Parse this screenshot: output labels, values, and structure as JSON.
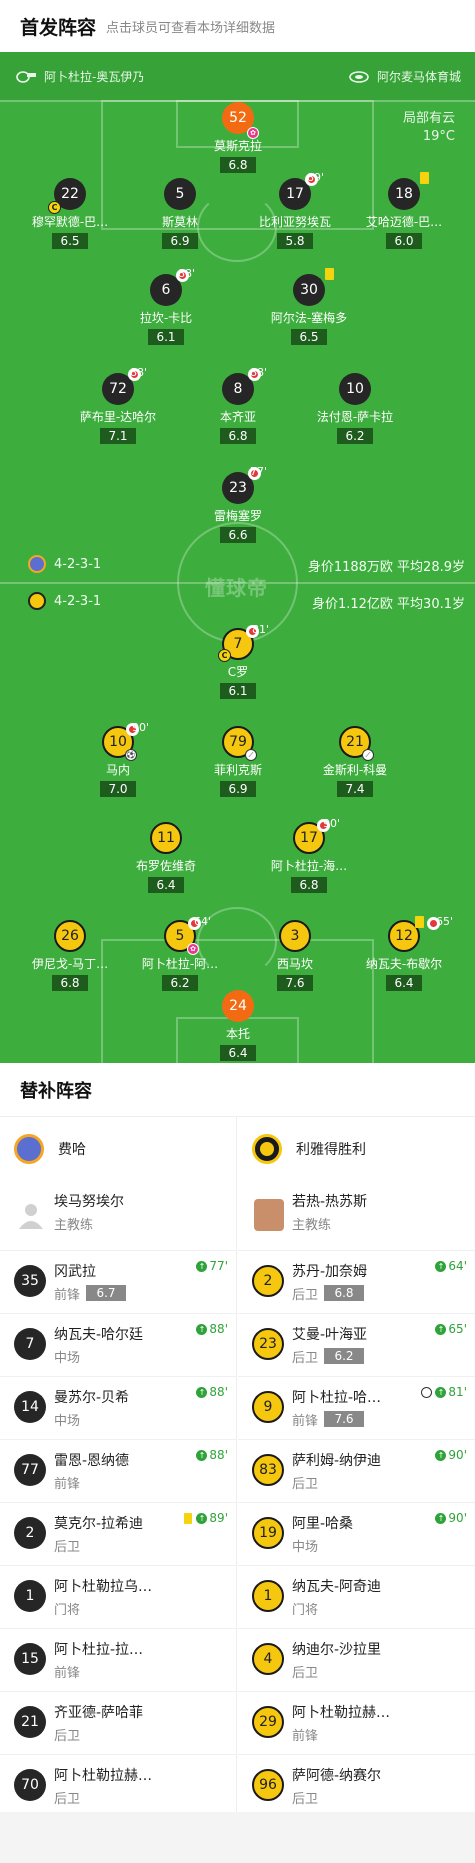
{
  "header": {
    "title": "首发阵容",
    "hint": "点击球员可查看本场详细数据"
  },
  "pitch": {
    "home_team": "阿卜杜拉-奥瓦伊乃",
    "venue": "阿尔麦马体育城",
    "weather": "局部有云",
    "temperature": "19°C",
    "watermark": "懂球帝",
    "home_formation": "4-2-3-1",
    "home_value": "身价1188万欧  平均28.9岁",
    "away_formation": "4-2-3-1",
    "away_value": "身价1.12亿欧  平均30.1岁",
    "colors": {
      "pitch": "#3dae3d",
      "home_circle": "#262626",
      "away_circle": "#f5c70f",
      "gk_circle": "#f26b12"
    }
  },
  "home_players": [
    {
      "num": "52",
      "name": "莫斯克拉",
      "rating": "6.8",
      "style": "orange",
      "icon": "award-icon"
    },
    {
      "num": "22",
      "name": "穆罕默德-巴…",
      "rating": "6.5",
      "style": "dark",
      "captain": true
    },
    {
      "num": "5",
      "name": "斯莫林",
      "rating": "6.9",
      "style": "dark"
    },
    {
      "num": "17",
      "name": "比利亚努埃瓦",
      "rating": "5.8",
      "style": "dark",
      "sub_min": "89'"
    },
    {
      "num": "18",
      "name": "艾哈迈德-巴…",
      "rating": "6.0",
      "style": "dark",
      "yellow": true
    },
    {
      "num": "6",
      "name": "拉坎-卡比",
      "rating": "6.1",
      "style": "dark",
      "sub_min": "88'"
    },
    {
      "num": "30",
      "name": "阿尔法-塞梅多",
      "rating": "6.5",
      "style": "dark",
      "yellow": true
    },
    {
      "num": "72",
      "name": "萨布里-达哈尔",
      "rating": "7.1",
      "style": "dark",
      "sub_min": "88'"
    },
    {
      "num": "8",
      "name": "本齐亚",
      "rating": "6.8",
      "style": "dark",
      "sub_min": "88'"
    },
    {
      "num": "10",
      "name": "法付恩-萨卡拉",
      "rating": "6.2",
      "style": "dark"
    },
    {
      "num": "23",
      "name": "雷梅塞罗",
      "rating": "6.6",
      "style": "dark",
      "sub_min": "77'"
    }
  ],
  "away_players": [
    {
      "num": "7",
      "name": "C罗",
      "rating": "6.1",
      "style": "yellow",
      "sub_min": "81'",
      "captain": true
    },
    {
      "num": "10",
      "name": "马内",
      "rating": "7.0",
      "style": "yellow",
      "sub_min": "90'",
      "goal": true
    },
    {
      "num": "79",
      "name": "菲利克斯",
      "rating": "6.9",
      "style": "yellow",
      "assist": true
    },
    {
      "num": "21",
      "name": "金斯利-科曼",
      "rating": "7.4",
      "style": "yellow",
      "assist": true
    },
    {
      "num": "11",
      "name": "布罗佐维奇",
      "rating": "6.4",
      "style": "yellow"
    },
    {
      "num": "17",
      "name": "阿卜杜拉-海…",
      "rating": "6.8",
      "style": "yellow",
      "sub_min": "90'"
    },
    {
      "num": "26",
      "name": "伊尼戈-马丁…",
      "rating": "6.8",
      "style": "yellow"
    },
    {
      "num": "5",
      "name": "阿卜杜拉-阿…",
      "rating": "6.2",
      "style": "yellow",
      "sub_min": "64'",
      "award": true
    },
    {
      "num": "3",
      "name": "西马坎",
      "rating": "7.6",
      "style": "yellow"
    },
    {
      "num": "12",
      "name": "纳瓦夫-布歇尔",
      "rating": "6.4",
      "style": "yellow",
      "sub_min": "65'",
      "yellow_card": true
    },
    {
      "num": "24",
      "name": "本托",
      "rating": "6.4",
      "style": "orange"
    }
  ],
  "subs_title": "替补阵容",
  "home_bench": {
    "team_name": "费哈",
    "coach_name": "埃马努埃尔",
    "coach_role": "主教练",
    "players": [
      {
        "num": "35",
        "name": "冈武拉",
        "pos": "前锋",
        "rating": "6.7",
        "in": "77'"
      },
      {
        "num": "7",
        "name": "纳瓦夫-哈尔廷",
        "pos": "中场",
        "in": "88'"
      },
      {
        "num": "14",
        "name": "曼苏尔-贝希",
        "pos": "中场",
        "in": "88'"
      },
      {
        "num": "77",
        "name": "雷恩-恩纳德",
        "pos": "前锋",
        "in": "88'"
      },
      {
        "num": "2",
        "name": "莫克尔-拉希迪",
        "pos": "后卫",
        "in": "89'",
        "yellow": true
      },
      {
        "num": "1",
        "name": "阿卜杜勒拉乌…",
        "pos": "门将"
      },
      {
        "num": "15",
        "name": "阿卜杜拉-拉…",
        "pos": "前锋"
      },
      {
        "num": "21",
        "name": "齐亚德-萨哈菲",
        "pos": "后卫"
      },
      {
        "num": "70",
        "name": "阿卜杜勒拉赫…",
        "pos": "后卫"
      }
    ]
  },
  "away_bench": {
    "team_name": "利雅得胜利",
    "coach_name": "若热-热苏斯",
    "coach_role": "主教练",
    "players": [
      {
        "num": "2",
        "name": "苏丹-加奈姆",
        "pos": "后卫",
        "rating": "6.8",
        "in": "64'"
      },
      {
        "num": "23",
        "name": "艾曼-叶海亚",
        "pos": "后卫",
        "rating": "6.2",
        "in": "65'"
      },
      {
        "num": "9",
        "name": "阿卜杜拉-哈…",
        "pos": "前锋",
        "rating": "7.6",
        "in": "81'",
        "goal": true
      },
      {
        "num": "83",
        "name": "萨利姆-纳伊迪",
        "pos": "后卫",
        "in": "90'"
      },
      {
        "num": "19",
        "name": "阿里-哈桑",
        "pos": "中场",
        "in": "90'"
      },
      {
        "num": "1",
        "name": "纳瓦夫-阿奇迪",
        "pos": "门将"
      },
      {
        "num": "4",
        "name": "纳迪尔-沙拉里",
        "pos": "后卫"
      },
      {
        "num": "29",
        "name": "阿卜杜勒拉赫…",
        "pos": "前锋"
      },
      {
        "num": "96",
        "name": "萨阿德-纳赛尔",
        "pos": "后卫"
      }
    ]
  }
}
